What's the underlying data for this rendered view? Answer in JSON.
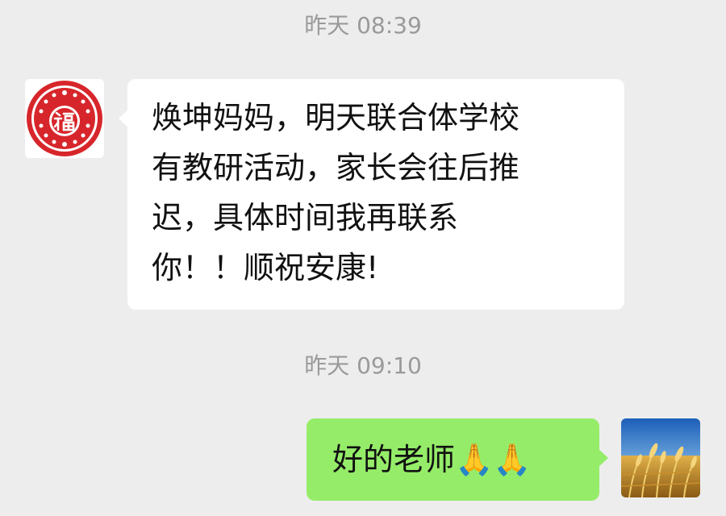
{
  "chat": {
    "messages": [
      {
        "time": "昨天 08:39",
        "sender": "contact",
        "lines": [
          "焕坤妈妈，明天联合体学校",
          "有教研活动，家长会往后推",
          "迟，具体时间我再联系",
          "你！！顺祝安康!"
        ],
        "avatar_icon": "fu-papercut-avatar"
      },
      {
        "time": "昨天 09:10",
        "sender": "me",
        "text": "好的老师🙏🙏",
        "avatar_icon": "wheat-field-avatar"
      }
    ]
  },
  "colors": {
    "background": "#ededed",
    "incoming_bubble": "#ffffff",
    "outgoing_bubble": "#95ec69",
    "timestamp": "#9a9a9a",
    "avatar_red": "#d7262b"
  }
}
